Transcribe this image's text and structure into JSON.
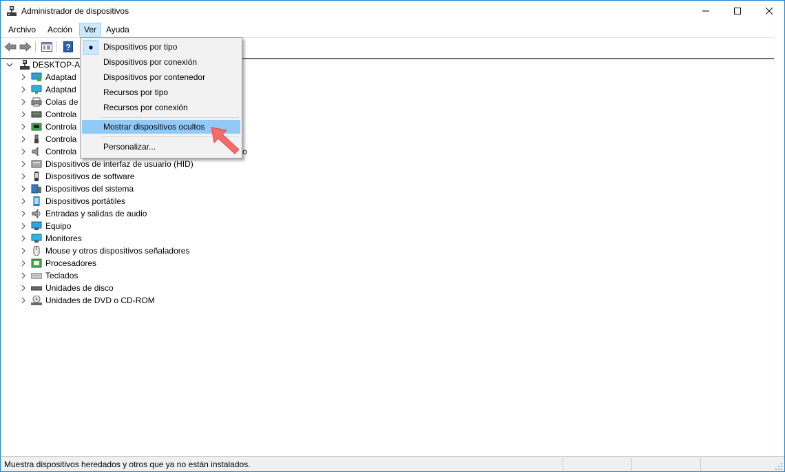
{
  "window": {
    "title": "Administrador de dispositivos",
    "accent_color": "#1883d7"
  },
  "menubar": {
    "items": [
      "Archivo",
      "Acción",
      "Ver",
      "Ayuda"
    ],
    "active": "Ver"
  },
  "toolbar": {
    "buttons": [
      "back-arrow-icon",
      "forward-arrow-icon",
      "properties-icon",
      "help-icon"
    ]
  },
  "tree": {
    "root": "DESKTOP-AR",
    "items": [
      {
        "label": "Adaptad",
        "icon": "network-adapter-icon"
      },
      {
        "label": "Adaptad",
        "icon": "display-adapter-icon"
      },
      {
        "label": "Colas de",
        "icon": "print-queue-icon"
      },
      {
        "label": "Controla",
        "icon": "storage-controller-icon"
      },
      {
        "label": "Controla",
        "icon": "ide-controller-icon"
      },
      {
        "label": "Controla",
        "icon": "usb-controller-icon"
      },
      {
        "label": "Controla",
        "icon": "sound-controller-icon"
      },
      {
        "label": "Dispositivos de interfaz de usuario (HID)",
        "icon": "hid-icon"
      },
      {
        "label": "Dispositivos de software",
        "icon": "software-device-icon"
      },
      {
        "label": "Dispositivos del sistema",
        "icon": "system-device-icon"
      },
      {
        "label": "Dispositivos portátiles",
        "icon": "portable-device-icon"
      },
      {
        "label": "Entradas y salidas de audio",
        "icon": "audio-io-icon"
      },
      {
        "label": "Equipo",
        "icon": "computer-icon"
      },
      {
        "label": "Monitores",
        "icon": "monitor-icon"
      },
      {
        "label": "Mouse y otros dispositivos señaladores",
        "icon": "mouse-icon"
      },
      {
        "label": "Procesadores",
        "icon": "processor-icon"
      },
      {
        "label": "Teclados",
        "icon": "keyboard-icon"
      },
      {
        "label": "Unidades de disco",
        "icon": "disk-drive-icon"
      },
      {
        "label": "Unidades de DVD o CD-ROM",
        "icon": "dvd-drive-icon"
      }
    ],
    "row7_trailing_fragment": "o"
  },
  "view_menu": {
    "items": [
      {
        "label": "Dispositivos por tipo",
        "checked": true
      },
      {
        "label": "Dispositivos por conexión",
        "checked": false
      },
      {
        "label": "Dispositivos por contenedor",
        "checked": false
      },
      {
        "label": "Recursos por tipo",
        "checked": false
      },
      {
        "label": "Recursos por conexión",
        "checked": false
      },
      {
        "label": "Mostrar dispositivos ocultos",
        "checked": false,
        "highlighted": true
      },
      {
        "label": "Personalizar...",
        "checked": false
      }
    ],
    "highlight_color": "#91c9f7"
  },
  "annotation": {
    "arrow_color": "#f76a6a"
  },
  "statusbar": {
    "text": "Muestra dispositivos heredados y otros que ya no están instalados."
  }
}
